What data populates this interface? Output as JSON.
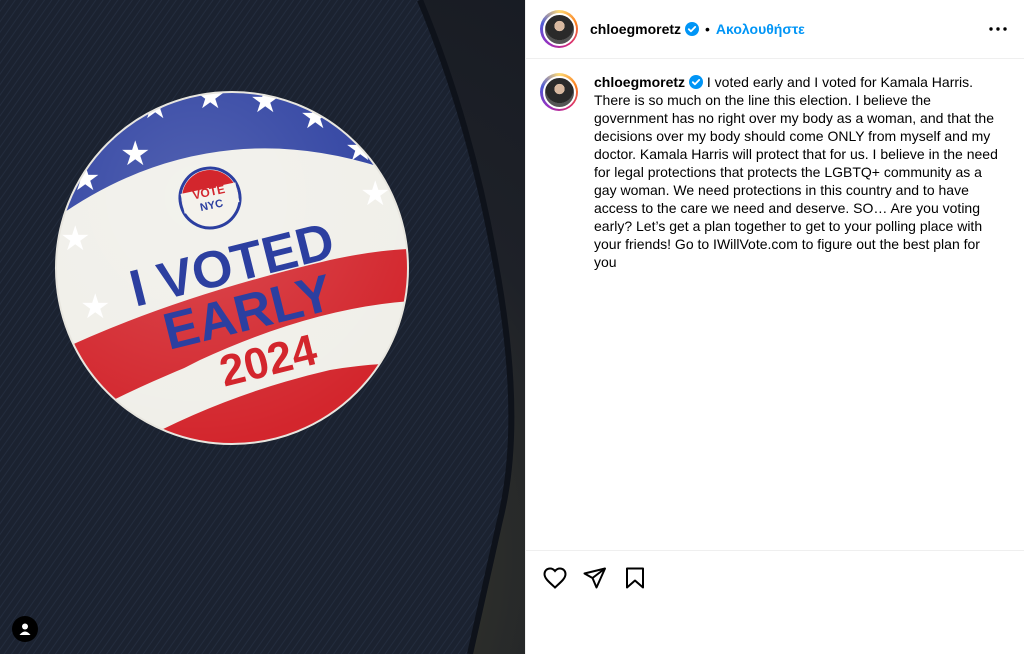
{
  "post": {
    "sticker": {
      "vote_badge_line1": "VOTE",
      "vote_badge_line2": "NYC",
      "line1": "I VOTED",
      "line2": "EARLY",
      "year": "2024"
    }
  },
  "header": {
    "username": "chloegmoretz",
    "separator": "•",
    "follow_label": "Ακολουθήστε"
  },
  "caption": {
    "username": "chloegmoretz",
    "text": "I voted early and I voted for Kamala Harris. There is so much on the line this election. I believe the government has no right over my body as a woman, and that the decisions over my body should come ONLY from myself and my doctor. Kamala Harris will protect that for us. I believe in the need for legal protections that protects the LGBTQ+ community as a gay woman. We need protections in this country and to have access to the care we need and deserve. SO… Are you voting early? Let’s get a plan together to get to your polling place with your friends! Go to IWillVote.com to figure out the best plan for you"
  },
  "icons": {
    "verified": "verified-badge-icon",
    "more": "more-options-icon",
    "like": "heart-icon",
    "share": "paper-plane-icon",
    "save": "bookmark-icon",
    "tag": "user-tag-icon"
  },
  "colors": {
    "link_blue": "#0095f6",
    "verified_blue": "#0095f6",
    "flag_red": "#d3262d",
    "flag_blue": "#2c3fa0",
    "denim": "#1c2230"
  }
}
